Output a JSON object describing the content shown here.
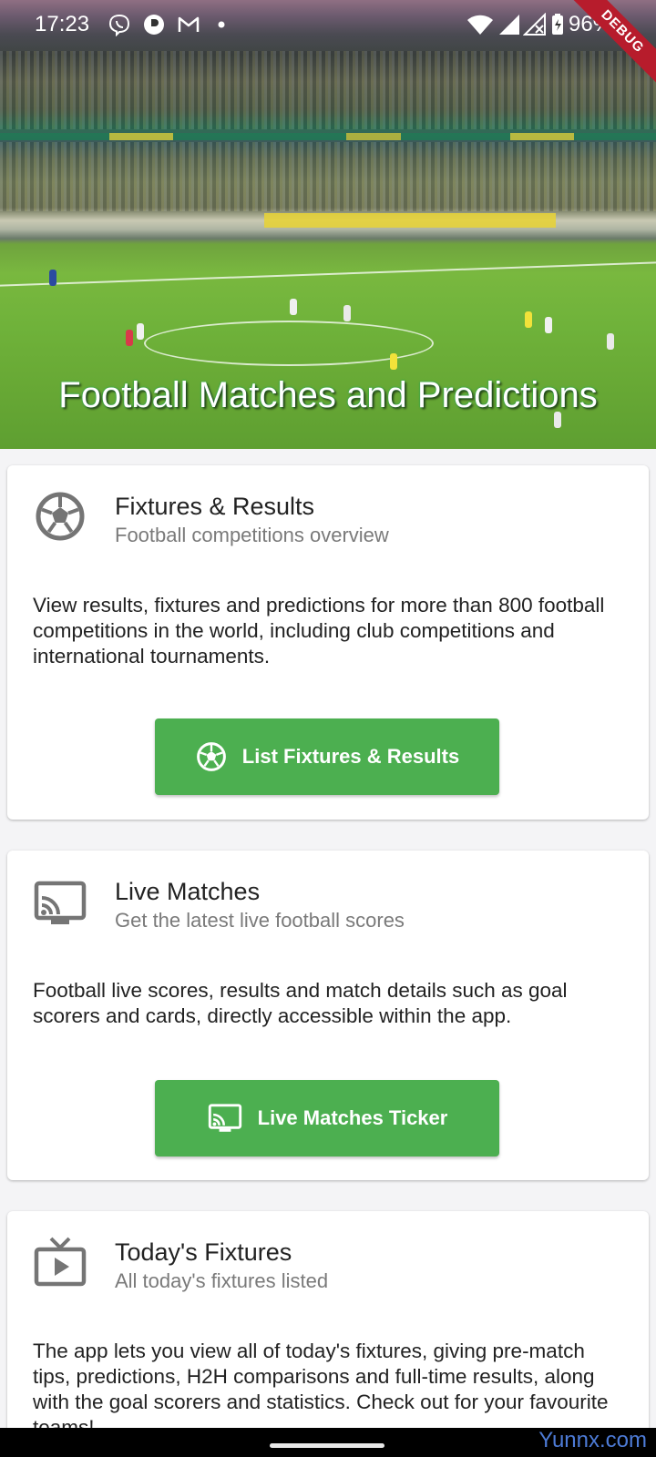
{
  "status_bar": {
    "time": "17:23",
    "battery": "96%",
    "debug_label": "DEBUG"
  },
  "hero": {
    "title": "Football Matches and Predictions"
  },
  "cards": [
    {
      "icon": "soccer-ball-icon",
      "title": "Fixtures & Results",
      "subtitle": "Football competitions overview",
      "description": "View results, fixtures and predictions for more than 800 football competitions in the world, including club competitions and international tournaments.",
      "button_label": "List Fixtures & Results",
      "button_icon": "soccer-ball-icon"
    },
    {
      "icon": "cast-icon",
      "title": "Live Matches",
      "subtitle": "Get the latest live football scores",
      "description": "Football live scores, results and match details such as goal scorers and cards, directly accessible within the app.",
      "button_label": "Live Matches Ticker",
      "button_icon": "cast-icon"
    },
    {
      "icon": "live-tv-icon",
      "title": "Today's Fixtures",
      "subtitle": "All today's fixtures listed",
      "description": "The app lets you view all of today's fixtures, giving pre-match tips, predictions, H2H comparisons and full-time results, along with the goal scorers and statistics. Check out for your favourite teams!"
    }
  ],
  "watermark": "Yunnx.com",
  "colors": {
    "button_green": "#4caf50",
    "icon_grey": "#757575",
    "debug_red": "#b71c2c"
  }
}
